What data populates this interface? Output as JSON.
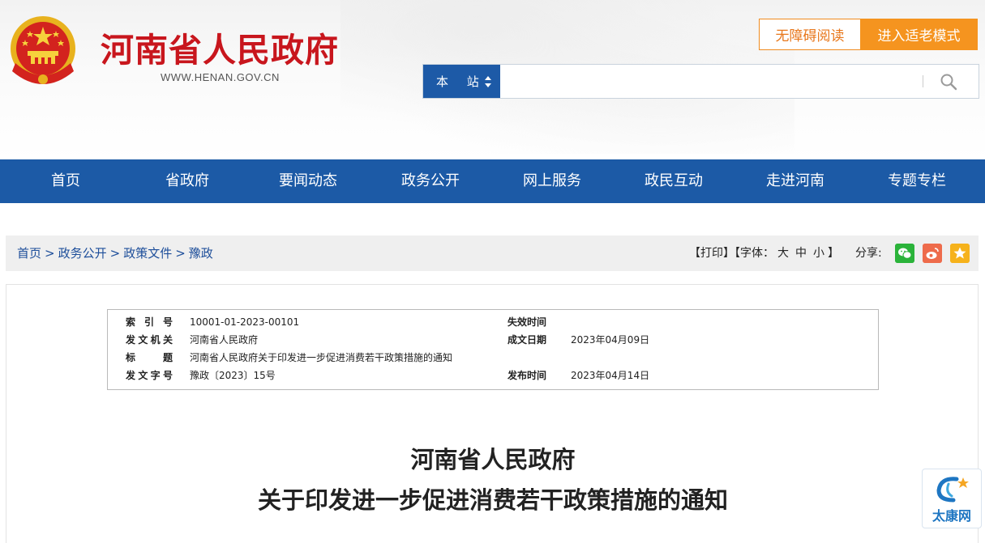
{
  "header": {
    "site_title": "河南省人民政府",
    "site_url": "WWW.HENAN.GOV.CN",
    "accessibility_button": "无障碍阅读",
    "elder_mode_button": "进入适老模式",
    "search": {
      "scope_label": "本 站",
      "query": "",
      "placeholder": ""
    },
    "colors": {
      "brand_red": "#c8161d",
      "accent_orange": "#f5941f",
      "nav_blue": "#1c5aa6"
    }
  },
  "nav": {
    "items": [
      "首页",
      "省政府",
      "要闻动态",
      "政务公开",
      "网上服务",
      "政民互动",
      "走进河南",
      "专题专栏"
    ]
  },
  "breadcrumb": {
    "items": [
      "首页",
      "政务公开",
      "政策文件",
      "豫政"
    ],
    "separator": ">"
  },
  "tools": {
    "print": "【打印】",
    "font_prefix": "【字体：",
    "font_large": "大",
    "font_medium": "中",
    "font_small": "小",
    "font_suffix": "】",
    "share_label": "分享:",
    "share_icons": [
      "wechat-icon",
      "weibo-icon",
      "favorite-icon"
    ]
  },
  "meta": {
    "rows": [
      {
        "k1": "索引号",
        "v1": "10001-01-2023-00101",
        "k2": "失效时间",
        "v2": ""
      },
      {
        "k1": "发文机关",
        "v1": "河南省人民政府",
        "k2": "成文日期",
        "v2": "2023年04月09日"
      },
      {
        "k1": "标题",
        "v1": "河南省人民政府关于印发进一步促进消费若干政策措施的通知",
        "k2": "",
        "v2": ""
      },
      {
        "k1": "发文字号",
        "v1": "豫政〔2023〕15号",
        "k2": "发布时间",
        "v2": "2023年04月14日"
      }
    ]
  },
  "document": {
    "title_line1": "河南省人民政府",
    "title_line2": "关于印发进一步促进消费若干政策措施的通知"
  },
  "float_logo": {
    "text": "太康网"
  }
}
